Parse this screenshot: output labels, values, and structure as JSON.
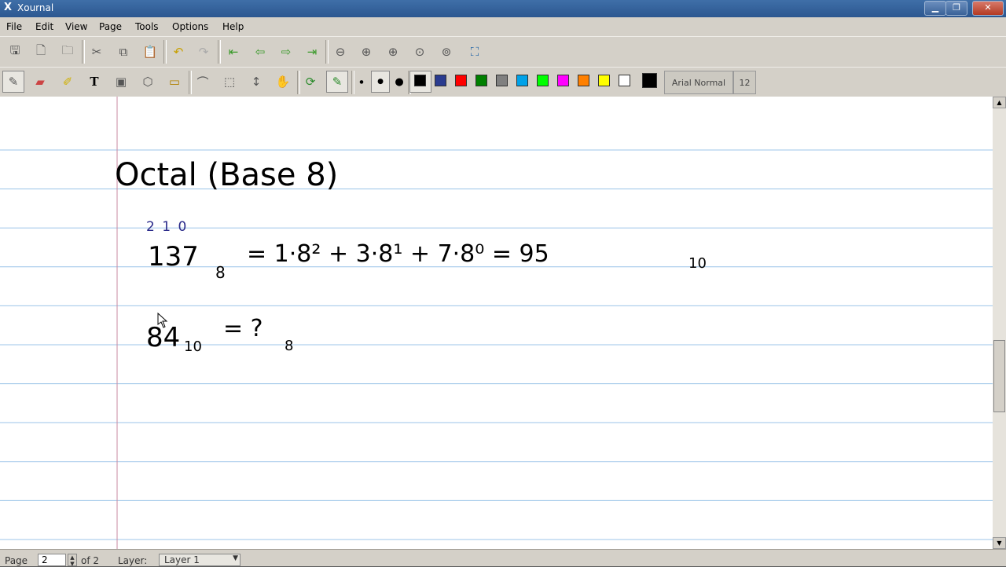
{
  "window": {
    "title": "Xournal",
    "buttons": {
      "minimize": "▁",
      "maximize": "❐",
      "close": "✕"
    }
  },
  "menu": [
    "File",
    "Edit",
    "View",
    "Page",
    "Tools",
    "Options",
    "Help"
  ],
  "toolbar1": {
    "icons": [
      "save-icon",
      "new-page-icon",
      "open-folder-icon",
      "cut-icon",
      "copy-icon",
      "paste-icon",
      "undo-icon",
      "redo-icon",
      "first-page-icon",
      "previous-page-icon",
      "next-page-icon",
      "last-page-icon",
      "zoom-out-icon",
      "zoom-in-icon",
      "zoom-in-2-icon",
      "zoom-100-icon",
      "zoom-fit-icon",
      "fullscreen-icon"
    ]
  },
  "toolbar2": {
    "tools": [
      "pen-icon",
      "eraser-icon",
      "highlighter-icon",
      "text-icon",
      "image-icon",
      "shape-recognizer-icon",
      "ruler-icon",
      "select-region-icon",
      "select-rectangle-icon",
      "vertical-space-icon",
      "hand-icon",
      "default-tool-icon",
      "default-pen-icon"
    ],
    "thickness": [
      "fine",
      "medium",
      "thick"
    ],
    "colors": [
      {
        "name": "black",
        "hex": "#000000"
      },
      {
        "name": "blue",
        "hex": "#2a3b8f"
      },
      {
        "name": "red",
        "hex": "#ff0000"
      },
      {
        "name": "green",
        "hex": "#008000"
      },
      {
        "name": "gray",
        "hex": "#808080"
      },
      {
        "name": "light-blue",
        "hex": "#00a2e8"
      },
      {
        "name": "light-green",
        "hex": "#00ff00"
      },
      {
        "name": "magenta",
        "hex": "#ff00ff"
      },
      {
        "name": "orange",
        "hex": "#ff8000"
      },
      {
        "name": "yellow",
        "hex": "#ffff00"
      },
      {
        "name": "white",
        "hex": "#ffffff"
      },
      {
        "name": "current",
        "hex": "#000000"
      }
    ],
    "font_name": "Arial Normal",
    "font_size": "12"
  },
  "page_content": {
    "heading": "Octal (Base 8)",
    "line1": {
      "place_values": "2   1   0",
      "expression": "137",
      "subscript": "8",
      "rhs": "= 1·8² + 3·8¹ + 7·8⁰ = 95",
      "rhs_subscript": "10"
    },
    "line2": {
      "expression": "84",
      "subscript": "10",
      "rhs": "= ?",
      "rhs_subscript": "8"
    }
  },
  "status": {
    "page_label": "Page",
    "page_value": "2",
    "page_total": "of 2",
    "layer_label": "Layer:",
    "layer_value": "Layer 1"
  }
}
